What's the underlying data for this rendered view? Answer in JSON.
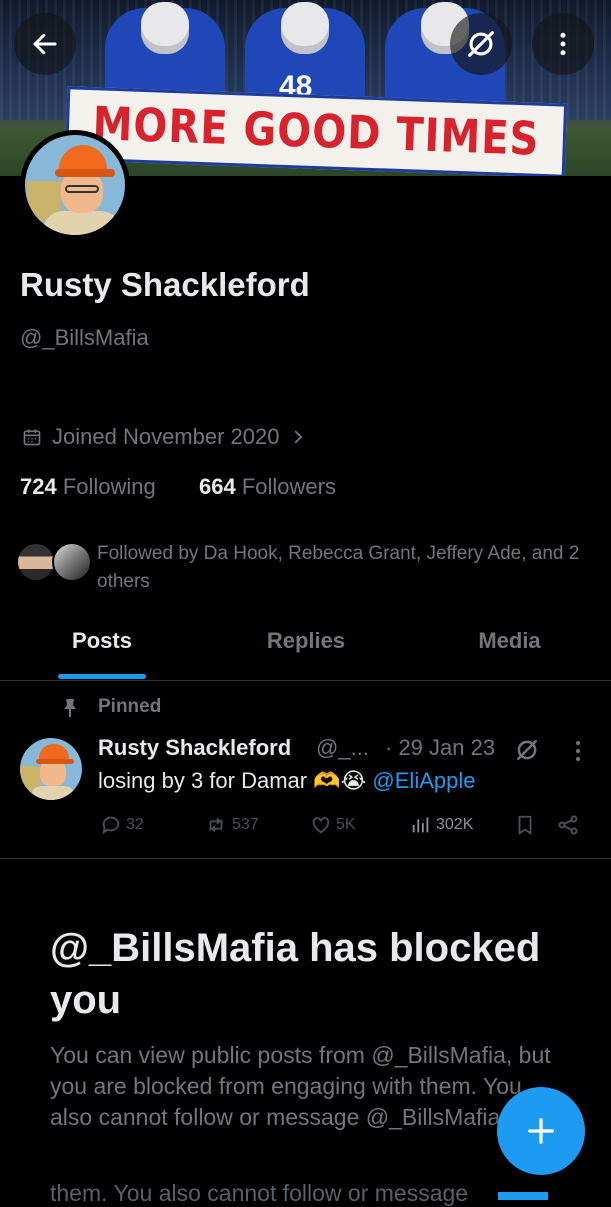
{
  "banner": {
    "sign_text": "MORE GOOD TIMES",
    "jersey_number": "48"
  },
  "header": {
    "back_icon": "arrow-left-icon",
    "grok_icon": "slashed-circle-icon",
    "more_icon": "vertical-dots-icon"
  },
  "profile": {
    "display_name": "Rusty Shackleford",
    "handle": "@_BillsMafia",
    "joined": "Joined November 2020",
    "following_count": "724",
    "following_label": "Following",
    "followers_count": "664",
    "followers_label": "Followers",
    "followed_by": "Followed by Da Hook, Rebecca Grant, Jeffery Ade, and 2 others"
  },
  "tabs": [
    {
      "label": "Posts",
      "active": true
    },
    {
      "label": "Replies",
      "active": false
    },
    {
      "label": "Media",
      "active": false
    }
  ],
  "pinned_post": {
    "pinned_label": "Pinned",
    "author_name": "Rusty Shackleford",
    "author_handle": "@_...",
    "date": "· 29 Jan 23",
    "text": "losing by 3 for Damar 🫶😭",
    "mention": "@EliApple",
    "replies": "32",
    "reposts": "537",
    "likes": "5K",
    "views": "302K"
  },
  "blocked": {
    "title": "@_BillsMafia has blocked you",
    "body": "You can view public posts from @_BillsMafia, but you are blocked from engaging with them. You also cannot follow or message @_BillsMafia.",
    "ghost_text": "them. You also cannot follow or message"
  },
  "colors": {
    "accent": "#1d9bf0",
    "background": "#000000",
    "text_primary": "#e7e9ea",
    "text_secondary": "#71767b",
    "divider": "#2f3336"
  }
}
